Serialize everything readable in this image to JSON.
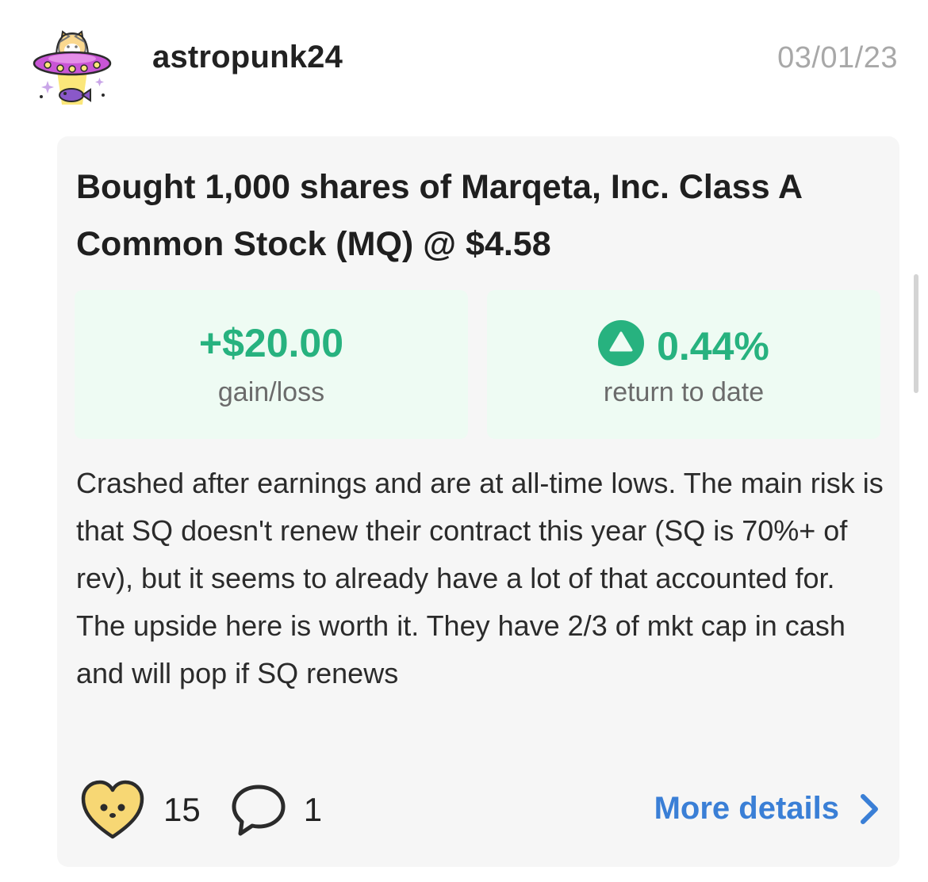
{
  "post": {
    "username": "astropunk24",
    "date": "03/01/23",
    "title": "Bought 1,000 shares of Marqeta, Inc. Class A Common Stock (MQ) @ $4.58",
    "gain": {
      "value": "+$20.00",
      "label": "gain/loss"
    },
    "return": {
      "value": "0.44%",
      "label": "return to date",
      "direction": "up"
    },
    "note": "Crashed after earnings and are at all-time lows. The main risk is that SQ doesn't renew their contract this year (SQ is 70%+ of rev), but it seems to already have a lot of that accounted for. The upside here is worth it. They have 2/3 of mkt cap in cash and will pop if SQ renews",
    "likes": "15",
    "comments": "1",
    "more_details_label": "More details"
  },
  "icons": {
    "avatar": "ufo-cat-avatar",
    "like": "heart-face-icon",
    "comment": "speech-bubble-icon",
    "return_direction": "triangle-up-icon",
    "more": "chevron-right-icon"
  },
  "colors": {
    "positive": "#27b27f",
    "positive_bg": "#eefbf3",
    "link": "#3a7fd6",
    "heart": "#f7d774",
    "avatar_purple": "#c955d6"
  }
}
